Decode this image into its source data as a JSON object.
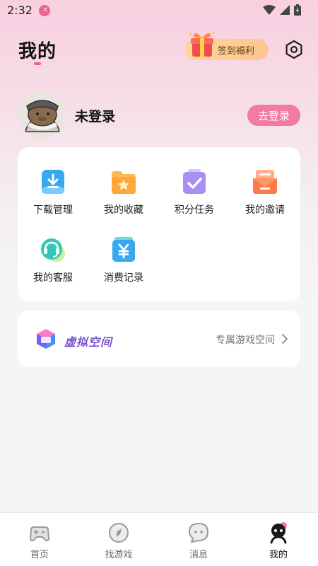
{
  "status_bar": {
    "time": "2:32"
  },
  "header": {
    "title": "我的",
    "checkin_label": "签到福利"
  },
  "profile": {
    "username": "未登录",
    "login_label": "去登录"
  },
  "menu": {
    "items": [
      {
        "label": "下载管理",
        "icon": "download-icon"
      },
      {
        "label": "我的收藏",
        "icon": "favorites-folder-icon"
      },
      {
        "label": "积分任务",
        "icon": "task-checkbox-icon"
      },
      {
        "label": "我的邀请",
        "icon": "invite-envelope-icon"
      },
      {
        "label": "我的客服",
        "icon": "headset-icon"
      },
      {
        "label": "消费记录",
        "icon": "yuan-wallet-icon"
      }
    ]
  },
  "virtual_space": {
    "label": "虚拟空间",
    "subtitle": "专属游戏空间"
  },
  "bottom_nav": {
    "items": [
      {
        "label": "首页",
        "icon": "gamepad-icon"
      },
      {
        "label": "找游戏",
        "icon": "compass-icon"
      },
      {
        "label": "消息",
        "icon": "chat-bubble-icon"
      },
      {
        "label": "我的",
        "icon": "profile-icon",
        "active": true
      }
    ]
  },
  "colors": {
    "accent_pink": "#f27aa3",
    "menu_blue": "#3aa8f0",
    "menu_orange": "#ffa83a",
    "menu_purple": "#a98ff5",
    "menu_red": "#ff7a4a",
    "menu_teal": "#36c6b8"
  }
}
